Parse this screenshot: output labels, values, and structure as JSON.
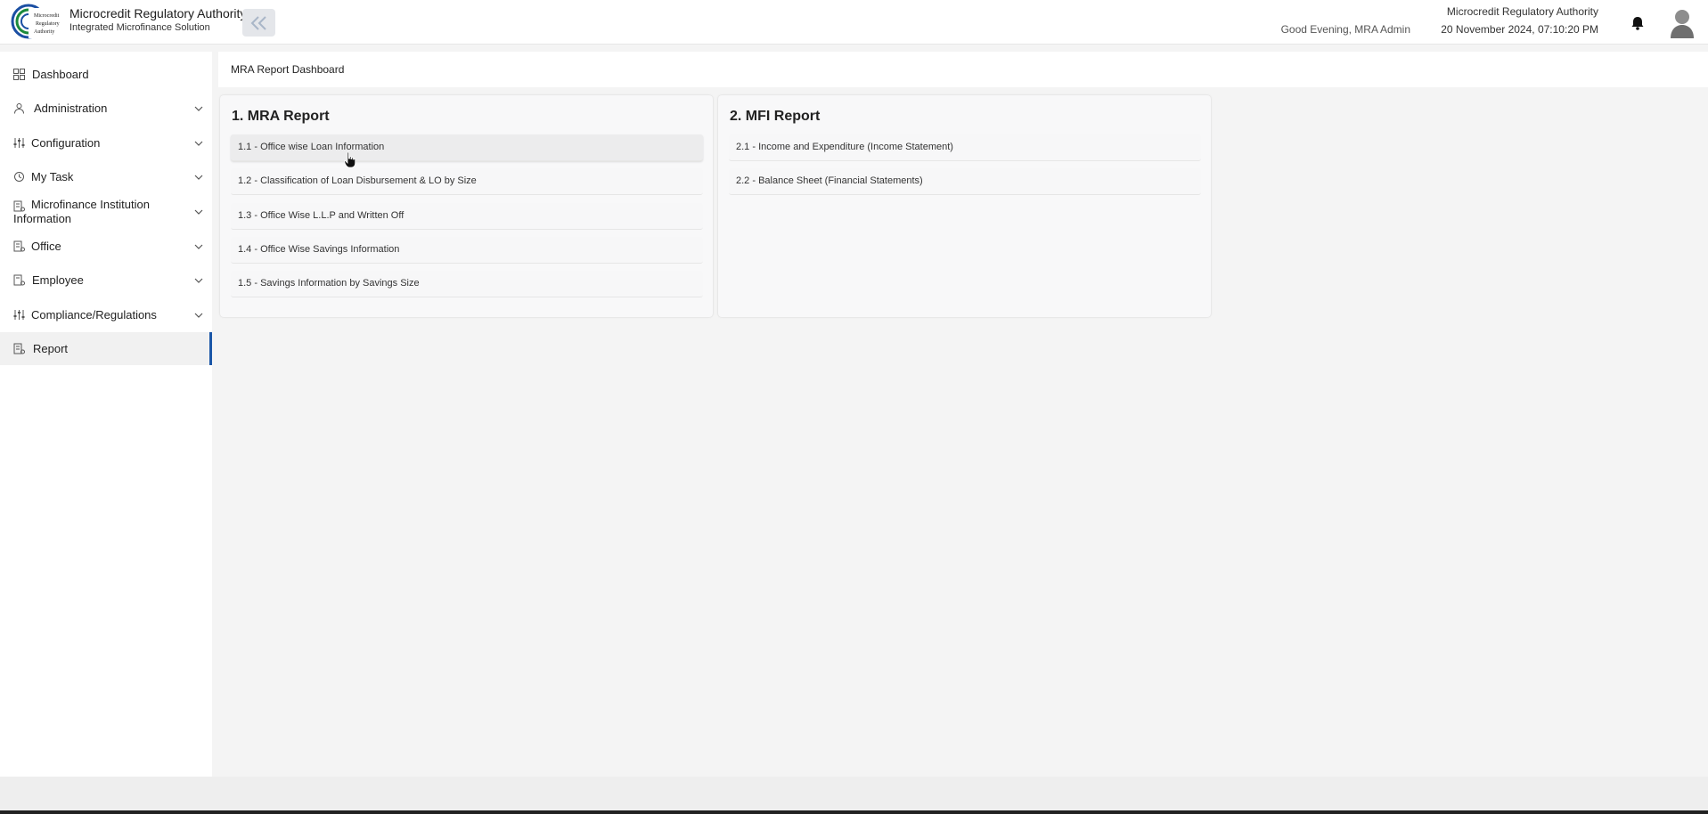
{
  "header": {
    "app_title": "Microcredit Regulatory Authority",
    "app_subtitle": "Integrated Microfinance Solution",
    "logo_text": [
      "Microcredit",
      "Regulatory",
      "Authority"
    ],
    "greeting": "Good Evening, MRA Admin",
    "org_name": "Microcredit Regulatory Authority",
    "datetime": "20 November 2024, 07:10:20 PM",
    "collapse_icon": "double-chevron-left-icon",
    "notification_icon": "bell-icon",
    "avatar_icon": "user-avatar-icon"
  },
  "sidebar": {
    "items": [
      {
        "label": "Dashboard",
        "icon": "grid-icon",
        "expandable": false
      },
      {
        "label": "Administration",
        "icon": "admin-icon",
        "expandable": true
      },
      {
        "label": "Configuration",
        "icon": "sliders-icon",
        "expandable": true
      },
      {
        "label": "My Task",
        "icon": "task-icon",
        "expandable": true
      },
      {
        "label_line1": "Microfinance Institution",
        "label_line2": "Information",
        "icon": "institution-icon",
        "expandable": true
      },
      {
        "label": "Office",
        "icon": "office-icon",
        "expandable": true
      },
      {
        "label": "Employee",
        "icon": "employee-icon",
        "expandable": true
      },
      {
        "label": "Compliance/Regulations",
        "icon": "sliders-icon",
        "expandable": true
      },
      {
        "label": "Report",
        "icon": "report-icon",
        "expandable": false,
        "active": true
      }
    ]
  },
  "main": {
    "page_title": "MRA Report Dashboard",
    "cards": [
      {
        "title": "1. MRA Report",
        "links": [
          "1.1 - Office wise Loan Information",
          "1.2 - Classification of Loan Disbursement & LO by Size",
          "1.3 - Office Wise L.L.P and Written Off",
          "1.4 - Office Wise Savings Information",
          "1.5 - Savings Information by Savings Size"
        ]
      },
      {
        "title": "2. MFI Report",
        "links": [
          "2.1 - Income and Expenditure (Income Statement)",
          "2.2 - Balance Sheet (Financial Statements)"
        ]
      }
    ]
  },
  "colors": {
    "active_accent": "#1a56a8",
    "logo_green": "#1c8a3c",
    "logo_blue": "#1b4fa3"
  }
}
